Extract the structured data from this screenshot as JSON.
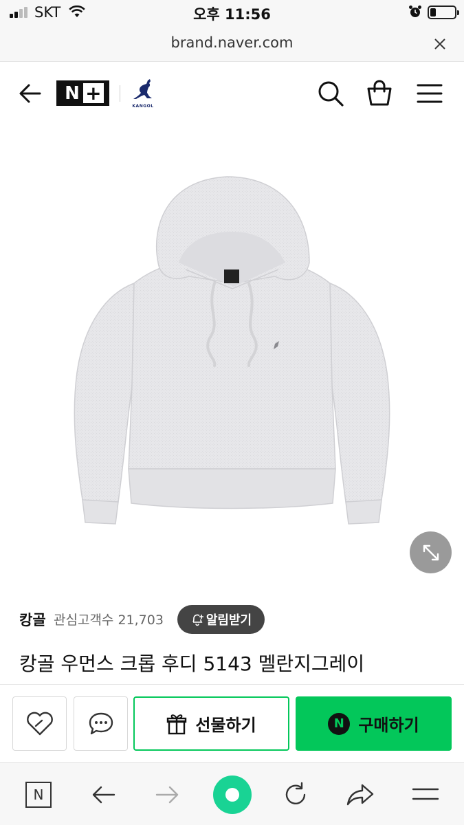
{
  "status_bar": {
    "carrier": "SKT",
    "time": "오후 11:56"
  },
  "url_bar": {
    "url": "brand.naver.com"
  },
  "header": {
    "nplus_logo": "N+",
    "kangol_logo_text": "KANGOL"
  },
  "product": {
    "brand": "캉골",
    "interest_label": "관심고객수 21,703",
    "alarm_button": "알림받기",
    "title": "캉골 우먼스 크롭 후디 5143 멜란지그레이"
  },
  "actions": {
    "gift_label": "선물하기",
    "buy_label": "구매하기",
    "buy_badge": "N"
  },
  "browser_toolbar": {
    "home_label": "N"
  },
  "colors": {
    "naver_green": "#03c75a",
    "toolbar_green": "#19d394",
    "dark_button": "#444444"
  },
  "icons": [
    "signal-icon",
    "wifi-icon",
    "alarm-clock-icon",
    "battery-icon",
    "close-icon",
    "back-arrow-icon",
    "search-icon",
    "shopping-bag-icon",
    "menu-icon",
    "expand-icon",
    "bell-plus-icon",
    "heart-icon",
    "chat-icon",
    "gift-icon",
    "arrow-left-icon",
    "arrow-right-icon",
    "refresh-icon",
    "share-icon",
    "hamburger-icon"
  ]
}
